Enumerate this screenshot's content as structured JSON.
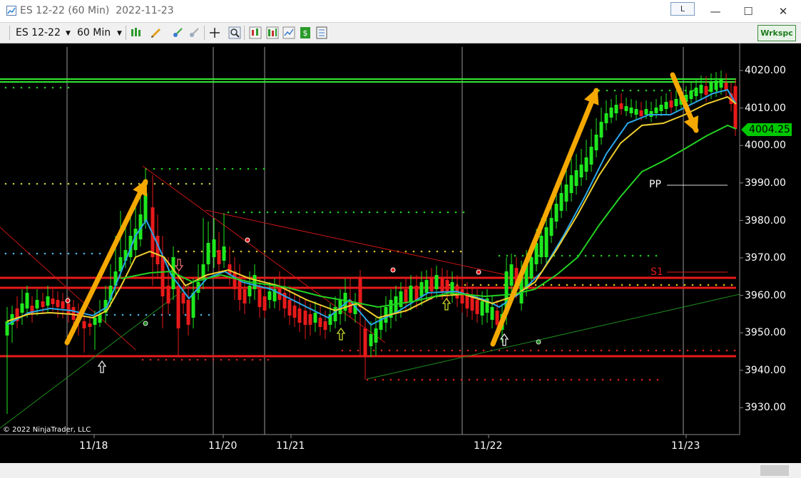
{
  "window": {
    "title": "ES 12-22 (60 Min)  2022-11-23",
    "l_button": "L",
    "minimize": "—",
    "maximize": "☐",
    "close": "✕"
  },
  "toolbar": {
    "instrument": "ES 12-22",
    "interval": "60 Min",
    "workspace": "Wrkspc"
  },
  "chart": {
    "price_labels": [
      "4020.00",
      "4010.00",
      "4000.00",
      "3990.00",
      "3980.00",
      "3970.00",
      "3960.00",
      "3950.00",
      "3940.00",
      "3930.00"
    ],
    "date_labels": [
      "11/18",
      "11/20",
      "11/21",
      "11/22",
      "11/23"
    ],
    "current_price": "4004.25",
    "pp_label": "PP",
    "s1_label": "S1",
    "copyright": "© 2022 NinjaTrader, LLC"
  },
  "colors": {
    "background": "#000000",
    "resistance_line": "#33e833",
    "support_line": "#e81a1a",
    "arrow": "#f5a800",
    "ema_fast": "#2aa6e8",
    "ema_mid": "#f0d030",
    "ema_slow": "#22d022"
  }
}
